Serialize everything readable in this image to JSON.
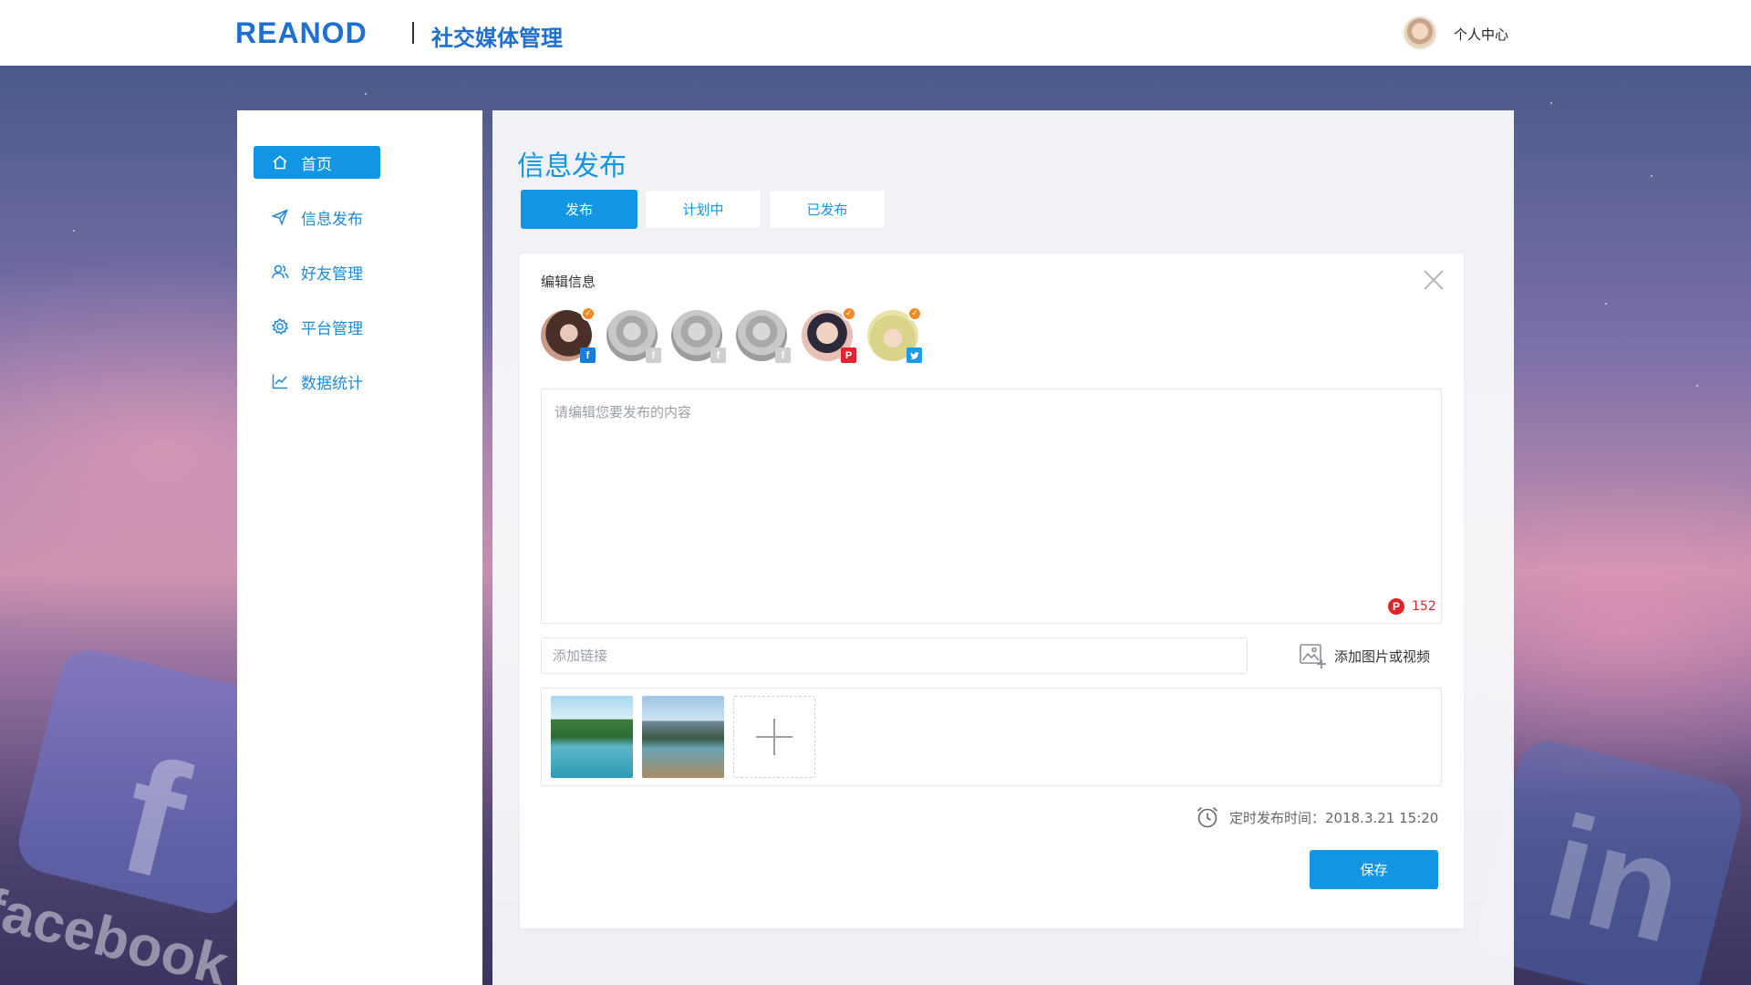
{
  "header": {
    "logo_text": "REANOD",
    "app_title": "社交媒体管理",
    "user_center": "个人中心"
  },
  "sidebar": {
    "items": [
      {
        "label": "首页",
        "icon": "home-icon",
        "active": true
      },
      {
        "label": "信息发布",
        "icon": "send-icon",
        "active": false
      },
      {
        "label": "好友管理",
        "icon": "users-icon",
        "active": false
      },
      {
        "label": "平台管理",
        "icon": "gear-icon",
        "active": false
      },
      {
        "label": "数据统计",
        "icon": "chart-icon",
        "active": false
      }
    ]
  },
  "main": {
    "title": "信息发布",
    "tabs": [
      {
        "label": "发布",
        "active": true
      },
      {
        "label": "计划中",
        "active": false
      },
      {
        "label": "已发布",
        "active": false
      }
    ],
    "card": {
      "title": "编辑信息",
      "accounts": [
        {
          "platform": "facebook",
          "selected": true
        },
        {
          "platform": "facebook",
          "selected": false
        },
        {
          "platform": "facebook",
          "selected": false
        },
        {
          "platform": "facebook",
          "selected": false
        },
        {
          "platform": "pinterest",
          "selected": true
        },
        {
          "platform": "twitter",
          "selected": true
        }
      ],
      "editor_placeholder": "请编辑您要发布的内容",
      "char_counter": "152",
      "link_placeholder": "添加链接",
      "add_media_label": "添加图片或视频",
      "schedule_label": "定时发布时间：2018.3.21 15:20",
      "save_label": "保存"
    }
  },
  "background": {
    "facebook_word": "facebook",
    "linkedin_word": "in"
  },
  "colors": {
    "accent": "#1296e3",
    "brand": "#1f6fd0",
    "check": "#f08a24",
    "pinterest": "#e0232c",
    "twitter": "#1c9be6"
  }
}
